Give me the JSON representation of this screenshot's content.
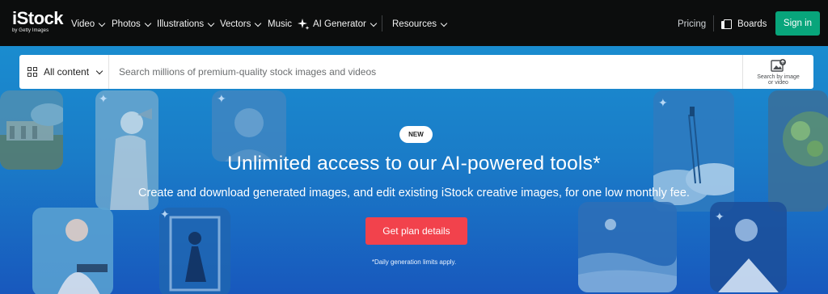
{
  "brand": {
    "name": "iStock",
    "tagline": "by Getty Images"
  },
  "nav": {
    "video": "Video",
    "photos": "Photos",
    "illustrations": "Illustrations",
    "vectors": "Vectors",
    "music": "Music",
    "ai_generator": "AI Generator",
    "resources": "Resources",
    "pricing": "Pricing",
    "boards": "Boards",
    "sign_in": "Sign in"
  },
  "search": {
    "content_filter": "All content",
    "placeholder": "Search millions of premium-quality stock images and videos",
    "image_search_label": "Search by image or video"
  },
  "hero": {
    "badge": "NEW",
    "headline": "Unlimited access to our AI-powered tools*",
    "subheadline": "Create and download generated images, and edit existing iStock creative images, for one low monthly fee.",
    "cta": "Get plan details",
    "disclaimer": "*Daily generation limits apply."
  },
  "colors": {
    "nav_bg": "#0c0d0d",
    "sign_in": "#08a57b",
    "cta": "#f2424c",
    "hero_top": "#1a8ccf",
    "hero_bottom": "#1858bd"
  }
}
